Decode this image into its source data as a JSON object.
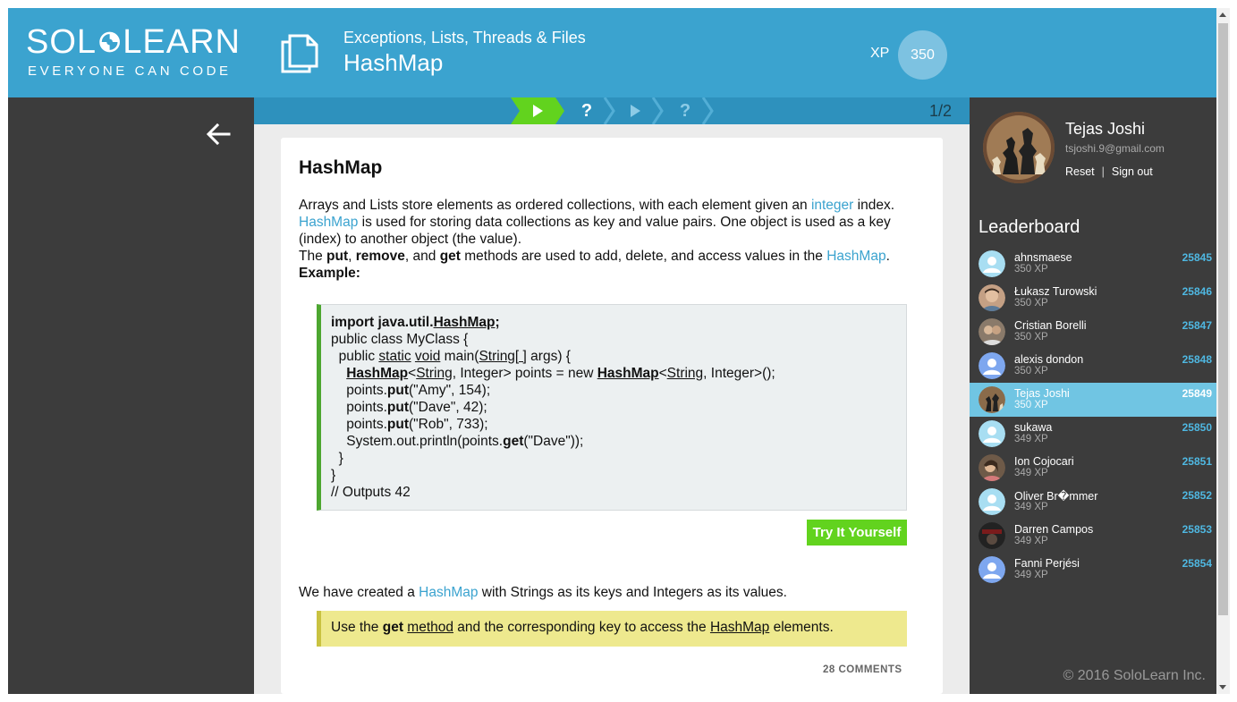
{
  "header": {
    "logo_main_left": "SOL",
    "logo_main_right": "LEARN",
    "logo_tagline": "EVERYONE CAN CODE",
    "course_title": "Exceptions, Lists, Threads & Files",
    "lesson_title": "HashMap",
    "xp_label": "XP",
    "xp_value": "350"
  },
  "progress": {
    "steps": [
      {
        "type": "play",
        "state": "current"
      },
      {
        "type": "question",
        "glyph": "?",
        "state": "upcoming-bright"
      },
      {
        "type": "play",
        "state": "upcoming"
      },
      {
        "type": "question",
        "glyph": "?",
        "state": "upcoming"
      }
    ],
    "page_count": "1/2"
  },
  "lesson": {
    "heading": "HashMap",
    "intro": {
      "p1_a": "Arrays and Lists store elements as ordered collections, with each element given an ",
      "p1_kw": "integer",
      "p1_b": " index.",
      "p2_kw": "HashMap",
      "p2_b": " is used for storing data collections as key and value pairs. One object is used as a key (index) to another object (the value).",
      "p3_a": "The ",
      "p3_put": "put",
      "p3_sep1": ", ",
      "p3_remove": "remove",
      "p3_sep2": ", and ",
      "p3_get": "get",
      "p3_b": " methods are used to add, delete, and access values in the ",
      "p3_kw": "HashMap",
      "p3_end": ".",
      "example_label": "Example:"
    },
    "code": {
      "l1_import": "import java.util.",
      "l1_hashmap": "HashMap",
      "l1_end": ";",
      "l2": "public class MyClass {",
      "l3_a": "  public ",
      "l3_static": "static",
      "l3_sp": " ",
      "l3_void": "void",
      "l3_b": " main(",
      "l3_string": "String[ ]",
      "l3_c": " args) {",
      "l4_hashmap": "HashMap",
      "l4_lt": "<",
      "l4_string": "String",
      "l4_b": ", Integer> points = new ",
      "l4_hashmap2": "HashMap",
      "l4_lt2": "<",
      "l4_string2": "String",
      "l4_c": ", Integer>();",
      "l5_a": "    points.",
      "l5_put": "put",
      "l5_b": "(\"Amy\", 154);",
      "l6_a": "    points.",
      "l6_put": "put",
      "l6_b": "(\"Dave\", 42);",
      "l7_a": "    points.",
      "l7_put": "put",
      "l7_b": "(\"Rob\", 733);",
      "l8_a": "    System.out.println(points.",
      "l8_get": "get",
      "l8_b": "(\"Dave\"));",
      "l9": "  }",
      "l10": "}",
      "l11": "// Outputs 42"
    },
    "try_button": "Try It Yourself",
    "summary_a": "We have created a ",
    "summary_kw": "HashMap",
    "summary_b": " with Strings as its keys and Integers as its values.",
    "tip_a": "Use the ",
    "tip_get": "get",
    "tip_sp": " ",
    "tip_method": "method",
    "tip_b": " and the corresponding key to access the ",
    "tip_hashmap": "HashMap",
    "tip_c": " elements.",
    "comments": "28 COMMENTS"
  },
  "profile": {
    "name": "Tejas Joshi",
    "email": "tsjoshi.9@gmail.com",
    "reset": "Reset",
    "separator": "|",
    "sign_out": "Sign out"
  },
  "leaderboard": {
    "title": "Leaderboard",
    "rows": [
      {
        "name": "ahnsmaese",
        "xp": "350 XP",
        "rank": "25845",
        "avatar": "default"
      },
      {
        "name": "Łukasz Turowski",
        "xp": "350 XP",
        "rank": "25846",
        "avatar": "photo"
      },
      {
        "name": "Cristian Borelli",
        "xp": "350 XP",
        "rank": "25847",
        "avatar": "photo"
      },
      {
        "name": "alexis dondon",
        "xp": "350 XP",
        "rank": "25848",
        "avatar": "default-blue"
      },
      {
        "name": "Tejas Joshi",
        "xp": "350 XP",
        "rank": "25849",
        "avatar": "photo",
        "active": true
      },
      {
        "name": "sukawa",
        "xp": "349 XP",
        "rank": "25850",
        "avatar": "default"
      },
      {
        "name": "Ion Cojocari",
        "xp": "349 XP",
        "rank": "25851",
        "avatar": "photo"
      },
      {
        "name": "Oliver Br�mmer",
        "xp": "349 XP",
        "rank": "25852",
        "avatar": "default"
      },
      {
        "name": "Darren Campos",
        "xp": "349 XP",
        "rank": "25853",
        "avatar": "photo"
      },
      {
        "name": "Fanni Perjési",
        "xp": "349 XP",
        "rank": "25854",
        "avatar": "default-blue"
      }
    ]
  },
  "footer": "© 2016 SoloLearn Inc.",
  "colors": {
    "brand_blue": "#3ba3cf",
    "accent_green": "#62d31e",
    "dark_bg": "#3c3c3c",
    "active_row": "#70c5e3"
  }
}
